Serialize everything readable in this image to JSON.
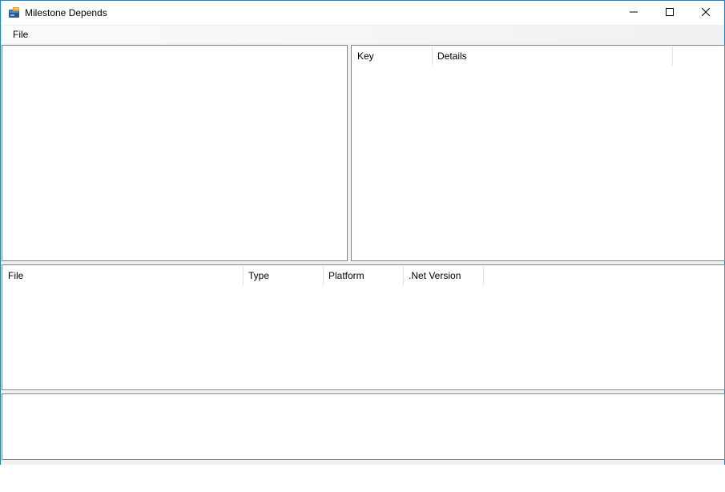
{
  "window": {
    "title": "Milestone Depends"
  },
  "menu": {
    "items": [
      {
        "label": "File"
      }
    ]
  },
  "details_list": {
    "columns": [
      {
        "label": "Key"
      },
      {
        "label": "Details"
      }
    ]
  },
  "files_list": {
    "columns": [
      {
        "label": "File"
      },
      {
        "label": "Type"
      },
      {
        "label": "Platform"
      },
      {
        "label": ".Net Version"
      }
    ]
  },
  "colors": {
    "window_border": "#1883d7",
    "panel_border": "#828790",
    "client_background": "#f0f0f0"
  }
}
